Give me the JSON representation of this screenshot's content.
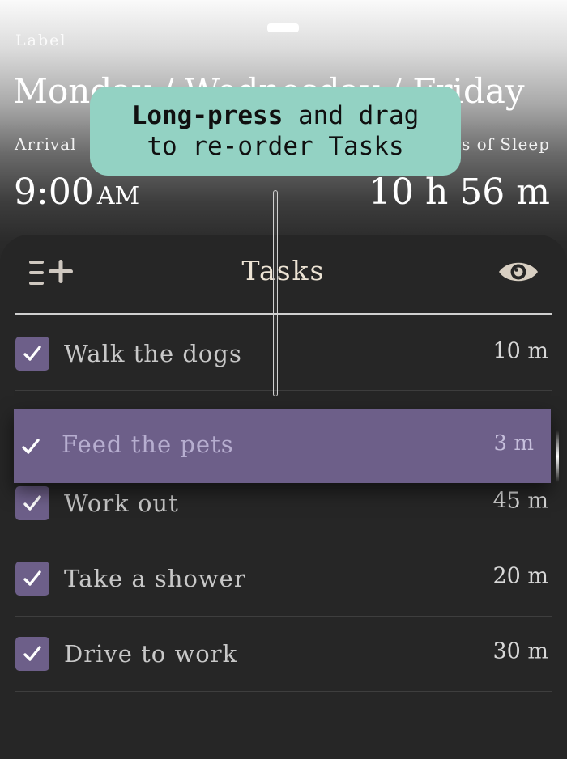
{
  "header": {
    "label_caption": "Label",
    "days": "Monday / Wednesday / Friday",
    "arrival_label": "Arrival",
    "arrival_time": "9:00",
    "arrival_ampm": "AM",
    "sleep_label": "Hours of Sleep",
    "sleep_value": "10 h  56 m"
  },
  "tooltip": {
    "bold": "Long-press",
    "rest_line1": " and drag",
    "line2": "to re-order Tasks"
  },
  "panel": {
    "title": "Tasks",
    "add_icon": "list-add-icon",
    "eye_icon": "eye-icon"
  },
  "tasks": [
    {
      "name": "Walk the dogs",
      "duration": "10 m",
      "checked": true
    },
    {
      "name": "Feed the pets",
      "duration": "3 m",
      "checked": true,
      "dragging": true
    },
    {
      "name": "Work out",
      "duration": "45 m",
      "checked": true
    },
    {
      "name": "Take a shower",
      "duration": "20 m",
      "checked": true
    },
    {
      "name": "Drive to work",
      "duration": "30 m",
      "checked": true
    }
  ],
  "colors": {
    "accent": "#6d5f89",
    "tooltip_bg": "#93d2c3",
    "panel_bg": "#262626",
    "title_text": "#ece3d4"
  }
}
